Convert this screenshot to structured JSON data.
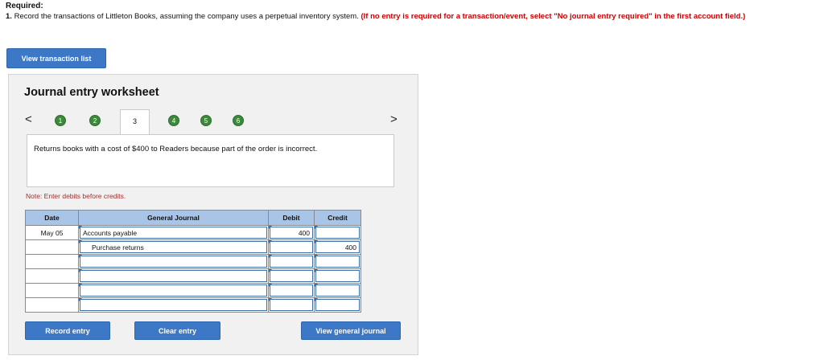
{
  "required": {
    "title": "Required:",
    "lead": "1.",
    "text": "Record the transactions of Littleton Books, assuming the company uses a perpetual inventory system.",
    "note": "(If no entry is required for a transaction/event, select \"No journal entry required\" in the first account field.)"
  },
  "buttons": {
    "view_transaction_list": "View transaction list",
    "record_entry": "Record entry",
    "clear_entry": "Clear entry",
    "view_general_journal": "View general journal"
  },
  "worksheet": {
    "title": "Journal entry worksheet",
    "prev_arrow": "<",
    "next_arrow": ">",
    "steps": [
      "1",
      "2",
      "3",
      "4",
      "5",
      "6"
    ],
    "current_step": "3",
    "description": "Returns books with a cost of $400 to Readers because part of the order is incorrect.",
    "note": "Note: Enter debits before credits."
  },
  "journal": {
    "headers": {
      "date": "Date",
      "account": "General Journal",
      "debit": "Debit",
      "credit": "Credit"
    },
    "rows": [
      {
        "date": "May 05",
        "account": "Accounts payable",
        "debit": "400",
        "credit": ""
      },
      {
        "date": "",
        "account": "Purchase returns",
        "debit": "",
        "credit": "400"
      },
      {
        "date": "",
        "account": "",
        "debit": "",
        "credit": ""
      },
      {
        "date": "",
        "account": "",
        "debit": "",
        "credit": ""
      },
      {
        "date": "",
        "account": "",
        "debit": "",
        "credit": ""
      },
      {
        "date": "",
        "account": "",
        "debit": "",
        "credit": ""
      }
    ]
  },
  "colors": {
    "button": "#3d78c6",
    "step_circle": "#3a8a3a",
    "note_red": "#cc0000",
    "header_blue": "#a8c4e6"
  }
}
